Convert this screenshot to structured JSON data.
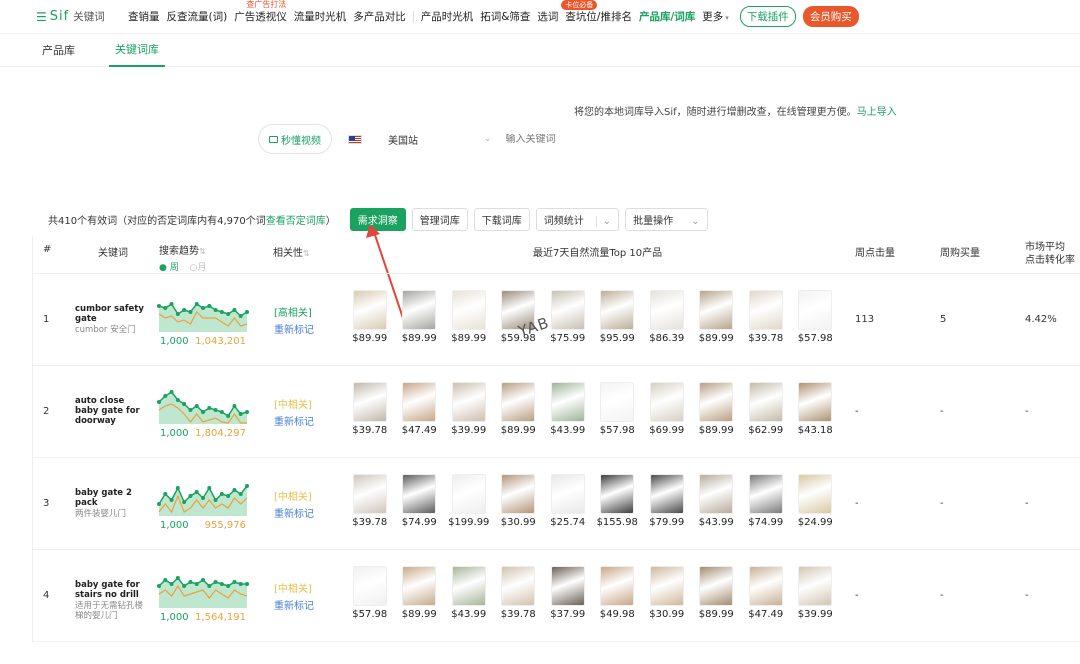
{
  "nav": {
    "menu_icon": "menu-icon",
    "brand": "Sif",
    "sub": "关键词",
    "items": [
      {
        "label": "查销量",
        "tag": ""
      },
      {
        "label": "反查流量(词)",
        "tag": ""
      },
      {
        "label": "广告透视仪",
        "tag": "查广告打法"
      },
      {
        "label": "流量时光机",
        "tag": ""
      },
      {
        "label": "多产品对比",
        "tag": ""
      }
    ],
    "items2": [
      {
        "label": "产品时光机",
        "tag": ""
      },
      {
        "label": "拓词&筛查",
        "tag": ""
      },
      {
        "label": "选词",
        "tag": ""
      },
      {
        "label": "查坑位/推排名",
        "tag": "卡位必备"
      },
      {
        "label": "产品库/词库",
        "tag": ""
      }
    ],
    "more": "更多",
    "download": "下载插件",
    "vip": "会员购买"
  },
  "subtabs": [
    "产品库",
    "关键词库"
  ],
  "notice": {
    "text": "将您的本地词库导入Sif，随时进行增删改查，在线管理更方便。",
    "link": "马上导入"
  },
  "search": {
    "video_btn": "秒懂视频",
    "site": "美国站",
    "placeholder": "输入关键词"
  },
  "toolbar": {
    "count_text": "共410个有效词（对应的否定词库内有4,970个词",
    "count_link": "查看否定词库",
    "count_close": "）",
    "buttons": [
      "需求洞察",
      "管理词库",
      "下载词库",
      "词频统计",
      "批量操作"
    ]
  },
  "table": {
    "headers": {
      "idx": "#",
      "keyword": "关键词",
      "trend": "搜索趋势",
      "week": "周",
      "month": "月",
      "relevance": "相关性",
      "products": "最近7天自然流量Top 10产品",
      "clicks": "周点击量",
      "buys": "周购买量",
      "cvr_line1": "市场平均",
      "cvr_line2": "点击转化率"
    },
    "rows": [
      {
        "idx": "1",
        "en": "cumbor safety gate",
        "cn": "cumbor 安全门",
        "lo": "1,000",
        "hi": "1,043,201",
        "rel": "[高相关]",
        "rel_level": "high",
        "mark": "重新标记",
        "prices": [
          "$89.99",
          "$89.99",
          "$89.99",
          "$59.98",
          "$75.99",
          "$95.99",
          "$86.39",
          "$89.99",
          "$39.78",
          "$57.98"
        ],
        "clicks": "113",
        "buys": "5",
        "cvr": "4.42%",
        "spark": [
          0.65,
          0.6,
          0.7,
          0.45,
          0.55,
          0.5,
          0.7,
          0.6,
          0.65,
          0.55,
          0.5,
          0.45,
          0.55,
          0.4,
          0.5
        ]
      },
      {
        "idx": "2",
        "en": "auto close baby gate for doorway",
        "cn": "",
        "lo": "1,000",
        "hi": "1,804,297",
        "rel": "[中相关]",
        "rel_level": "mid",
        "mark": "重新标记",
        "prices": [
          "$39.78",
          "$47.49",
          "$39.99",
          "$89.99",
          "$43.99",
          "$57.98",
          "$69.99",
          "$89.99",
          "$62.99",
          "$43.18"
        ],
        "clicks": "-",
        "buys": "-",
        "cvr": "-",
        "spark": [
          0.55,
          0.7,
          0.8,
          0.6,
          0.5,
          0.35,
          0.45,
          0.3,
          0.4,
          0.35,
          0.3,
          0.2,
          0.45,
          0.25,
          0.3
        ]
      },
      {
        "idx": "3",
        "en": "baby gate 2 pack",
        "cn": "两件装婴儿门",
        "lo": "1,000",
        "hi": "955,976",
        "rel": "[中相关]",
        "rel_level": "mid",
        "mark": "重新标记",
        "prices": [
          "$39.78",
          "$74.99",
          "$199.99",
          "$30.99",
          "$25.74",
          "$155.98",
          "$79.99",
          "$43.99",
          "$74.99",
          "$24.99"
        ],
        "clicks": "-",
        "buys": "-",
        "cvr": "-",
        "spark": [
          0.3,
          0.55,
          0.4,
          0.7,
          0.35,
          0.5,
          0.6,
          0.45,
          0.7,
          0.4,
          0.55,
          0.5,
          0.65,
          0.55,
          0.75
        ]
      },
      {
        "idx": "4",
        "en": "baby gate for stairs no drill",
        "cn": "适用于无需钻孔楼梯的婴儿门",
        "lo": "1,000",
        "hi": "1,564,191",
        "rel": "[中相关]",
        "rel_level": "mid",
        "mark": "重新标记",
        "prices": [
          "$57.98",
          "$89.99",
          "$43.99",
          "$39.78",
          "$37.99",
          "$49.98",
          "$30.99",
          "$89.99",
          "$47.49",
          "$39.99"
        ],
        "clicks": "-",
        "buys": "-",
        "cvr": "-",
        "spark": [
          0.55,
          0.7,
          0.6,
          0.75,
          0.55,
          0.65,
          0.6,
          0.7,
          0.55,
          0.65,
          0.6,
          0.55,
          0.65,
          0.6,
          0.6
        ]
      }
    ]
  },
  "watermark": "YAB",
  "colors": {
    "accent": "#1aa260",
    "orange": "#e9a33b",
    "red": "#e9572b",
    "blue_link": "#4a7fd6"
  },
  "product_image_palettes": [
    [
      "#d9cbb2",
      "#a6a6a0",
      "#e8e2d6",
      "#9c8d7b",
      "#c9c1b4",
      "#bcae98",
      "#e5e2dc",
      "#b7a48c",
      "#e1d7c9",
      "#f2f2f2"
    ],
    [
      "#c2b8ab",
      "#c7a789",
      "#cdbfae",
      "#b89f83",
      "#9eb49a",
      "#f3f3f3",
      "#d7d0c3",
      "#b9a083",
      "#c4bba9",
      "#ae9371"
    ],
    [
      "#cfc6bb",
      "#5c5c5c",
      "#eeeeee",
      "#b4957a",
      "#e8e8e8",
      "#3e3e3e",
      "#4a4a4a",
      "#b6ac9b",
      "#7a7a7a",
      "#d9c9a3"
    ],
    [
      "#f0f0f0",
      "#c8ab8b",
      "#a7b59b",
      "#d3c2af",
      "#6b6055",
      "#c9a688",
      "#cfb89b",
      "#a48c6f",
      "#c9b196",
      "#d2c6b4"
    ]
  ]
}
